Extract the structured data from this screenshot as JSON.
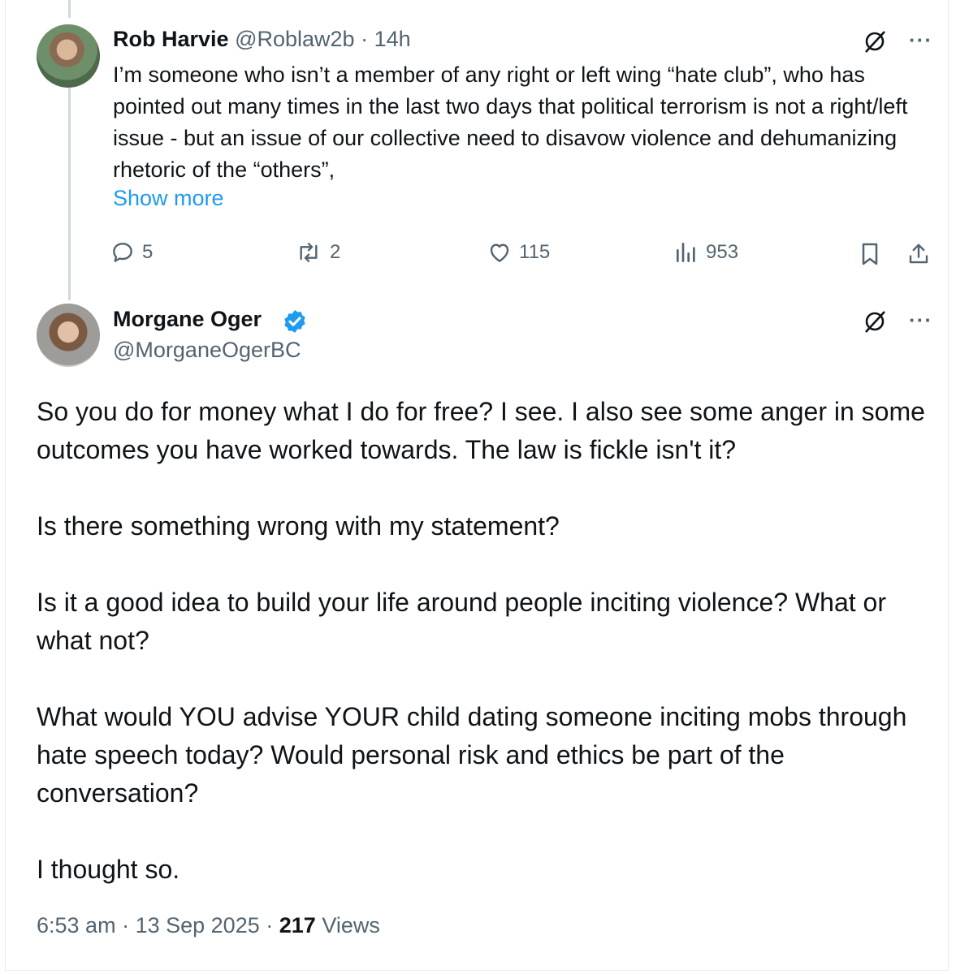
{
  "reply_tweet": {
    "author_name": "Rob Harvie",
    "author_handle": "@Roblaw2b",
    "separator": "·",
    "time": "14h",
    "text": "I’m someone who isn’t a member of any right or left wing “hate club”, who has pointed out many times in the last two days that political terrorism is not a right/left issue - but an issue of our collective need to disavow violence and dehumanizing rhetoric of the “others”,",
    "show_more": "Show more",
    "metrics": {
      "replies": "5",
      "reposts": "2",
      "likes": "115",
      "views": "953"
    }
  },
  "main_tweet": {
    "author_name": "Morgane Oger",
    "author_handle": "@MorganeOgerBC",
    "verified": true,
    "paragraphs": [
      "So you do for money what I do for free?  I see. I also see some anger in some outcomes you have worked towards. The law is fickle isn't it?",
      "Is there something wrong with my statement?",
      "Is it a good idea to build your life around people inciting violence? What or what not?",
      "What would YOU advise YOUR child dating someone inciting mobs through hate speech today?  Would personal risk and ethics be part of the conversation?",
      "I thought so."
    ],
    "time": "6:53 am",
    "date": "13 Sep 2025",
    "separator": "·",
    "views_count": "217",
    "views_label": "Views"
  },
  "icons": {
    "grok": "grok-icon",
    "more": "more-icon",
    "reply": "reply-icon",
    "repost": "repost-icon",
    "like": "like-icon",
    "views": "views-icon",
    "bookmark": "bookmark-icon",
    "share": "share-icon",
    "verified": "verified-badge-icon"
  },
  "colors": {
    "link": "#1d9bf0",
    "secondary": "#536471",
    "text": "#0f1419",
    "thread_line": "#cfd9de"
  }
}
